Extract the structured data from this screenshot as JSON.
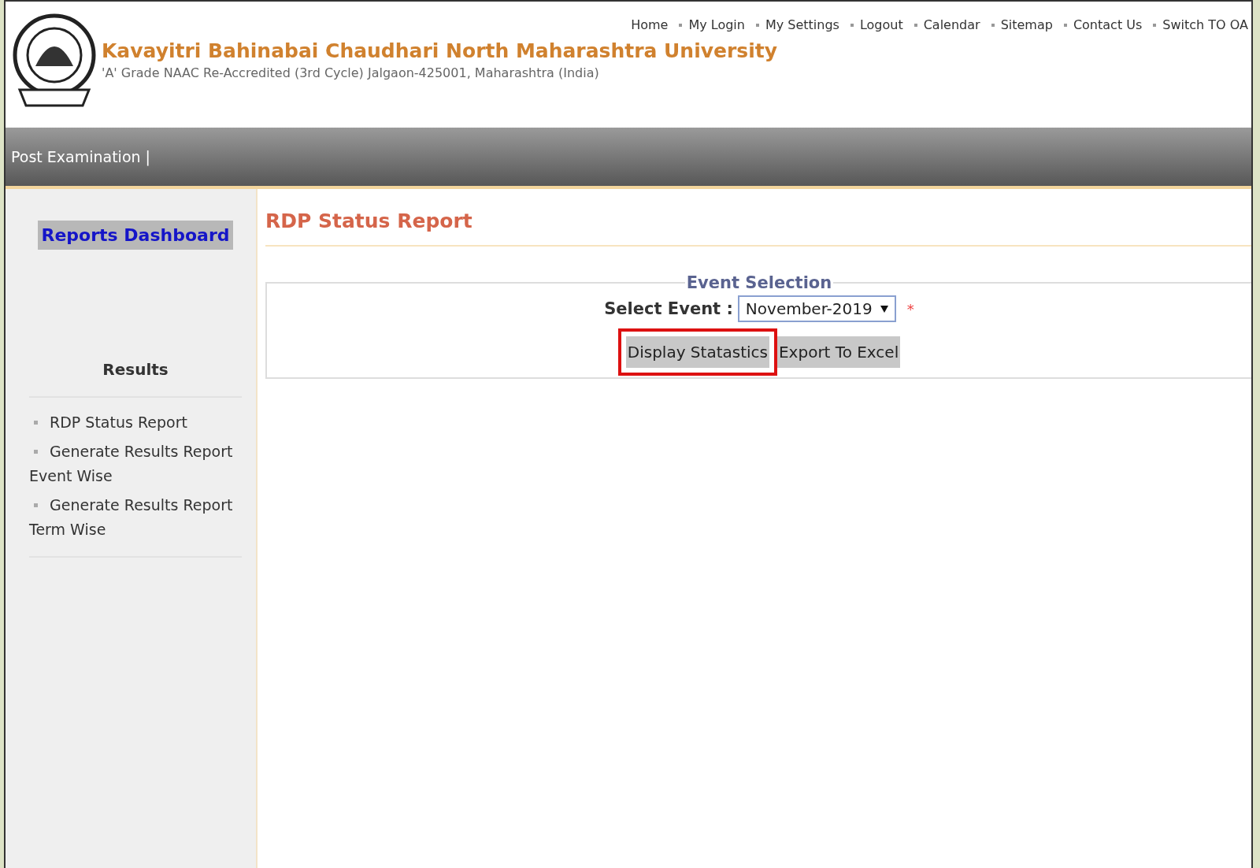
{
  "header": {
    "title": "Kavayitri Bahinabai Chaudhari North Maharashtra University",
    "subtitle": "'A' Grade NAAC Re-Accredited (3rd Cycle) Jalgaon-425001, Maharashtra (India)",
    "top_links": [
      {
        "label": "Home",
        "bullet": false
      },
      {
        "label": "My Login",
        "bullet": true
      },
      {
        "label": "My Settings",
        "bullet": true
      },
      {
        "label": "Logout",
        "bullet": true
      },
      {
        "label": "Calendar",
        "bullet": true
      },
      {
        "label": "Sitemap",
        "bullet": true
      },
      {
        "label": "Contact Us",
        "bullet": true
      },
      {
        "label": "Switch TO OA",
        "bullet": true
      }
    ]
  },
  "menu_bar": {
    "label": "Post Examination |"
  },
  "sidebar": {
    "dashboard_button": "Reports Dashboard",
    "section_title": "Results",
    "items": [
      {
        "label": "RDP Status Report"
      },
      {
        "label": "Generate Results Report Event Wise"
      },
      {
        "label": "Generate Results Report Term Wise"
      }
    ]
  },
  "main": {
    "title": "RDP Status Report",
    "fieldset_legend": "Event Selection",
    "field_label": "Select Event :",
    "select_value": "November-2019",
    "required_mark": "*",
    "buttons": [
      {
        "label": "Display Statastics",
        "highlighted": true
      },
      {
        "label": "Export To Excel",
        "highlighted": false
      }
    ]
  }
}
